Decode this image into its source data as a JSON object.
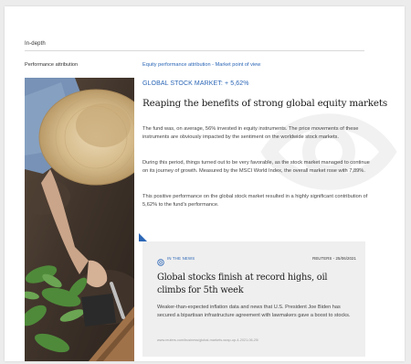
{
  "section": {
    "label": "In-depth"
  },
  "attribution": {
    "label": "Performance attribution",
    "link": "Equity performance attribution - Market point of view"
  },
  "article": {
    "kicker": "GLOBAL STOCK MARKET: + 5,62%",
    "title": "Reaping the benefits of strong global equity markets",
    "paragraphs": [
      "The fund was, on average, 56% invested in equity instruments. The price movements of these instruments are obviously impacted by the sentiment on the worldwide stock markets.",
      "During this period, things turned out to be very favorable, as the stock market managed to continue on its journey of growth. Measured by the MSCI World Index, the overall market rose with 7,89%.",
      "This positive performance on the global stock market resulted in a highly significant contribution of 5,62% to the fund's performance."
    ]
  },
  "news": {
    "tag": "IN THE NEWS",
    "source": "REUTERS - 25/06/2021",
    "title": "Global stocks finish at record highs, oil climbs for 5th week",
    "body": "Weaker-than-expected inflation data and news that U.S. President Joe Biden has secured a bipartisan infrastructure agreement with lawmakers gave a boost to stocks.",
    "url": "www.reuters.com/business/global-markets-wrap-up-4-2021-06-25/"
  },
  "colors": {
    "accent": "#2b66b6",
    "text": "#1d1d1d",
    "news_bg": "#efefef"
  },
  "icons": {
    "news": "news-globe-icon",
    "watermark": "eye-watermark-icon"
  }
}
